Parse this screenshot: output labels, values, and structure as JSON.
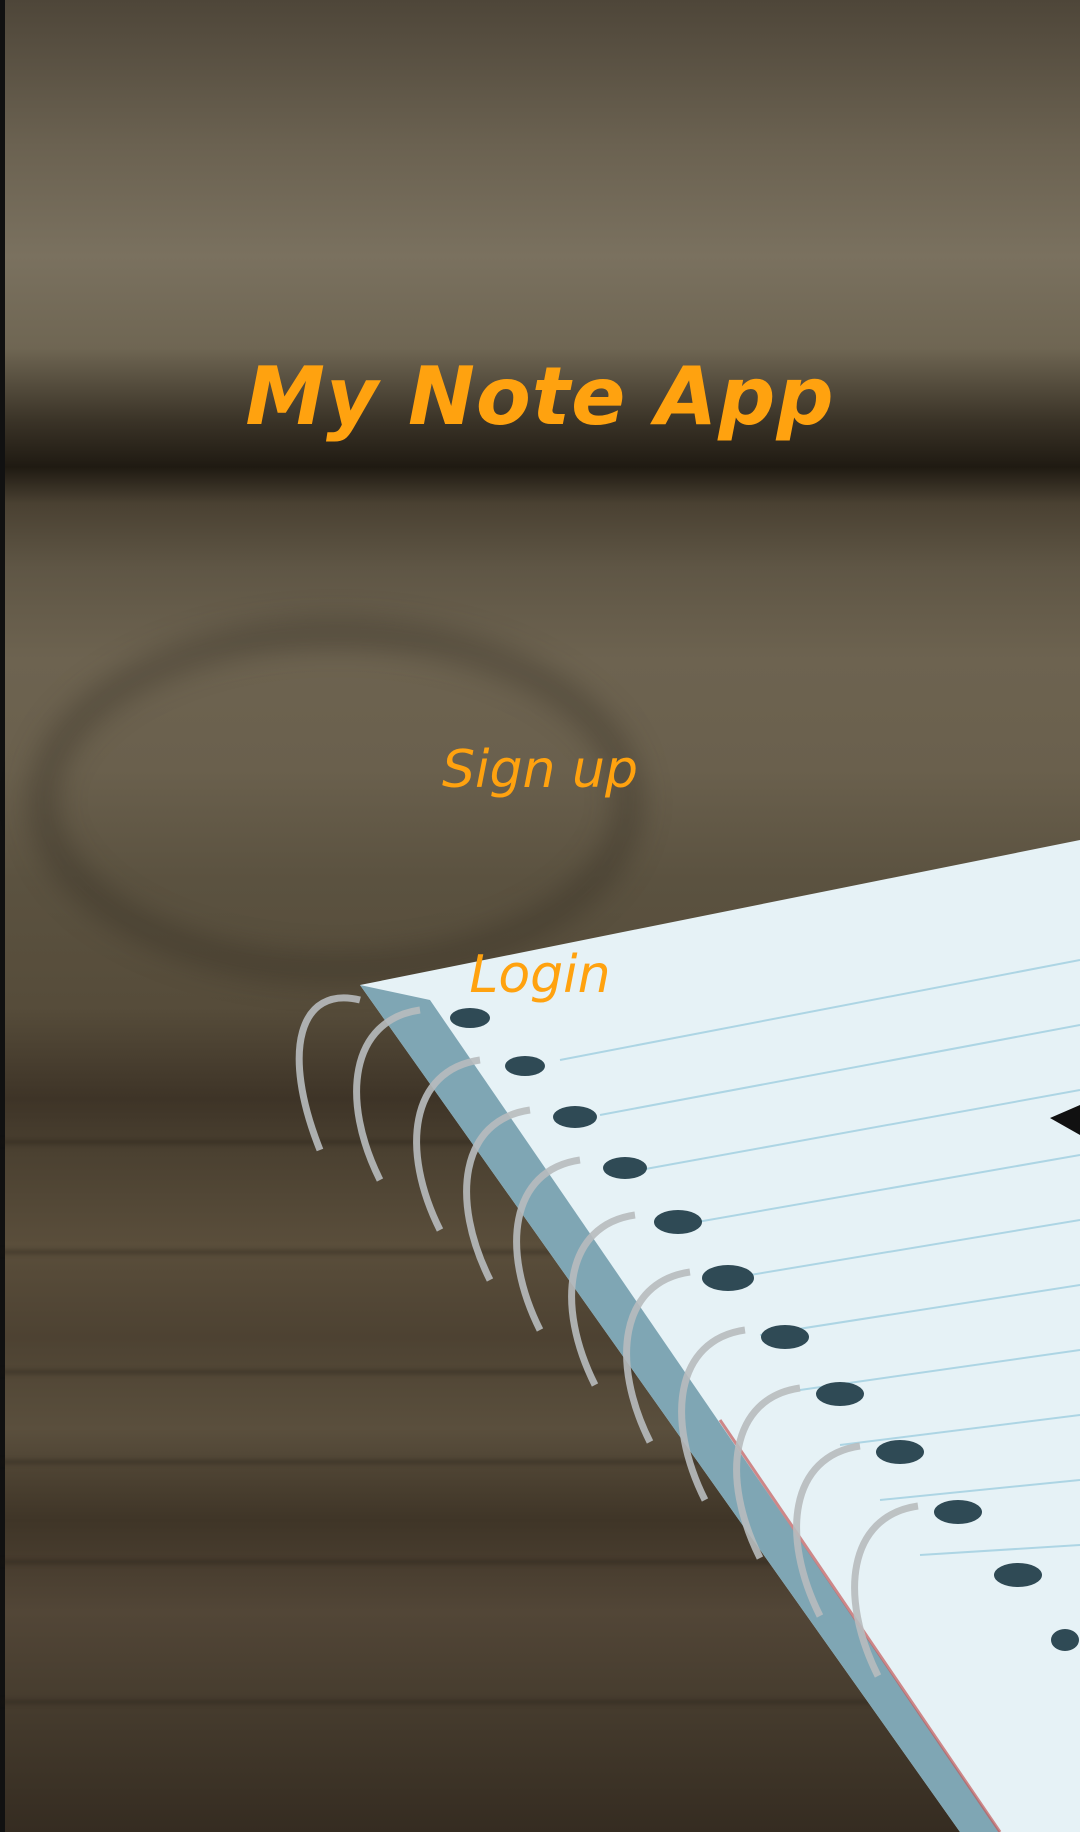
{
  "app": {
    "title": "My Note App"
  },
  "actions": {
    "signup_label": "Sign up",
    "login_label": "Login"
  },
  "colors": {
    "accent": "#ffa20f"
  }
}
